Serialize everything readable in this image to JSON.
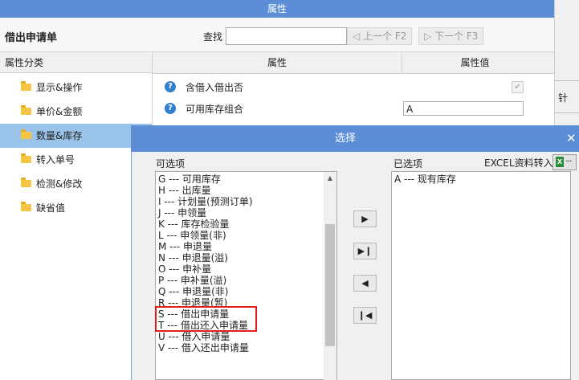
{
  "window": {
    "title": "属性"
  },
  "toolbar": {
    "doc_title": "借出申请单",
    "find_label": "查找",
    "find_value": "",
    "prev_label": "上一个 F2",
    "next_label": "下一个 F3"
  },
  "categories": {
    "header": "属性分类",
    "items": [
      {
        "label": "显示&操作"
      },
      {
        "label": "单价&金额"
      },
      {
        "label": "数量&库存"
      },
      {
        "label": "转入单号"
      },
      {
        "label": "检测&修改"
      },
      {
        "label": "缺省值"
      }
    ],
    "selected": "数量&库存"
  },
  "grid": {
    "col_attr": "属性",
    "col_value": "属性值",
    "rows": [
      {
        "name": "含借入借出否",
        "checked": true
      },
      {
        "name": "可用库存组合",
        "value": "A"
      }
    ]
  },
  "right_strip": {
    "glyph": "针"
  },
  "dialog": {
    "title": "选择",
    "close": "✕",
    "available_label": "可选项",
    "chosen_label": "已选项",
    "excel_label": "EXCEL资料转入",
    "excel_icon": "X",
    "excel_dots": "···",
    "available": [
      "G --- 可用库存",
      "H --- 出库量",
      "I --- 计划量(预测订单)",
      "J --- 申领量",
      "K --- 库存检验量",
      "L --- 申领量(非)",
      "M --- 申退量",
      "N --- 申退量(溢)",
      "O --- 申补量",
      "P --- 申补量(溢)",
      "Q --- 申退量(非)",
      "R --- 申退量(暂)",
      "S --- 借出申请量",
      "T --- 借出还入申请量",
      "U --- 借入申请量",
      "V --- 借入还出申请量"
    ],
    "chosen": [
      "A --- 现有库存"
    ],
    "buttons": {
      "add": "▶",
      "add_all": "▶❙",
      "remove": "◀",
      "remove_all": "❙◀"
    }
  },
  "icons": {
    "help": "?",
    "check": "✔",
    "prev": "◁",
    "next": "▷",
    "scroll_up": "▲"
  },
  "colors": {
    "titlebar": "#5b8ed6",
    "selected_category": "#99c3e8",
    "highlight_border": "#e01e1e"
  }
}
